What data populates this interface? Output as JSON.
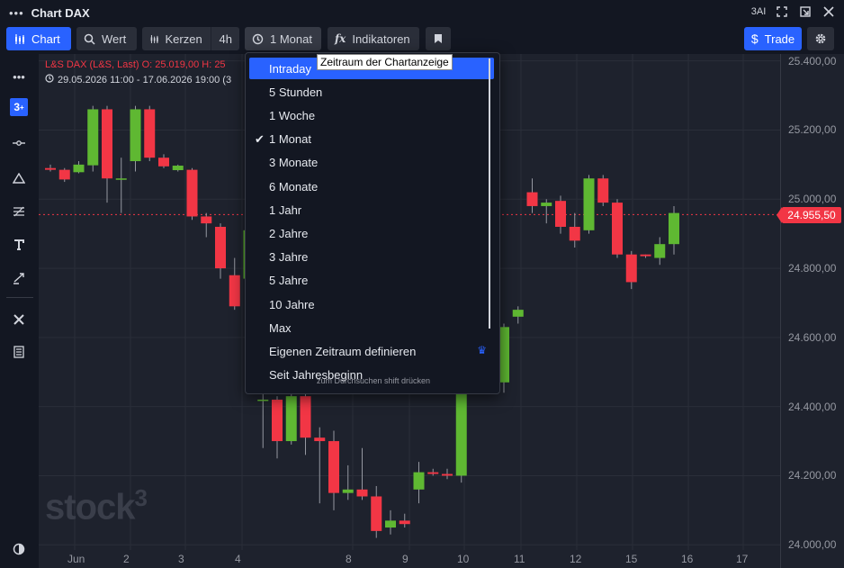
{
  "window": {
    "title": "Chart DAX",
    "brand_label": "3AI"
  },
  "toolbar": {
    "chart_label": "Chart",
    "search_label": "Wert",
    "candles_label": "Kerzen",
    "interval_label": "4h",
    "range_label": "1 Monat",
    "indicators_label": "Indikatoren",
    "trade_label": "Trade"
  },
  "legend": {
    "line1": "L&S DAX (L&S, Last)  O: 25.019,00  H: 25",
    "line2": "29.05.2026 11:00 - 17.06.2026 19:00  (3"
  },
  "price_tag": "24.955,50",
  "watermark": {
    "text": "stock",
    "sup": "3"
  },
  "dropdown": {
    "items": [
      {
        "label": "Intraday",
        "state": "highlighted"
      },
      {
        "label": "5 Stunden"
      },
      {
        "label": "1 Woche"
      },
      {
        "label": "1 Monat",
        "checked": true
      },
      {
        "label": "3 Monate"
      },
      {
        "label": "6 Monate"
      },
      {
        "label": "1 Jahr"
      },
      {
        "label": "2 Jahre"
      },
      {
        "label": "3 Jahre"
      },
      {
        "label": "5 Jahre"
      },
      {
        "label": "10 Jahre"
      },
      {
        "label": "Max"
      },
      {
        "label": "Eigenen Zeitraum definieren",
        "premium": true
      },
      {
        "label": "Seit Jahresbeginn"
      }
    ],
    "hint": "zum Durchsuchen shift drücken"
  },
  "tooltip": "Zeitraum der Chartanzeige",
  "colors": {
    "up": "#5fb832",
    "down": "#f23645",
    "accent": "#2962ff",
    "background": "#1e222d"
  },
  "chart_data": {
    "type": "candlestick",
    "x_tick_labels": [
      "Jun",
      "2",
      "3",
      "4",
      "8",
      "9",
      "10",
      "11",
      "12",
      "15",
      "16",
      "17"
    ],
    "y_tick_labels": [
      "25.400,00",
      "25.200,00",
      "25.000,00",
      "24.800,00",
      "24.600,00",
      "24.400,00",
      "24.200,00",
      "24.000,00"
    ],
    "ylim": [
      23985,
      25420
    ],
    "last_price": 24955.5,
    "candles": [
      {
        "o": 25090,
        "h": 25100,
        "l": 25080,
        "c": 25085
      },
      {
        "o": 25085,
        "h": 25090,
        "l": 25050,
        "c": 25057
      },
      {
        "o": 25078,
        "h": 25110,
        "l": 25075,
        "c": 25100
      },
      {
        "o": 25098,
        "h": 25270,
        "l": 25080,
        "c": 25260
      },
      {
        "o": 25260,
        "h": 25270,
        "l": 24990,
        "c": 25060
      },
      {
        "o": 25060,
        "h": 25120,
        "l": 24960,
        "c": 25060
      },
      {
        "o": 25110,
        "h": 25270,
        "l": 25080,
        "c": 25260
      },
      {
        "o": 25260,
        "h": 25270,
        "l": 25110,
        "c": 25120
      },
      {
        "o": 25120,
        "h": 25130,
        "l": 25090,
        "c": 25095
      },
      {
        "o": 25084,
        "h": 25100,
        "l": 25080,
        "c": 25097
      },
      {
        "o": 25085,
        "h": 25090,
        "l": 24940,
        "c": 24950
      },
      {
        "o": 24950,
        "h": 24960,
        "l": 24890,
        "c": 24930
      },
      {
        "o": 24920,
        "h": 24930,
        "l": 24770,
        "c": 24800
      },
      {
        "o": 24780,
        "h": 24830,
        "l": 24680,
        "c": 24690
      },
      {
        "o": 24770,
        "h": 24920,
        "l": 24700,
        "c": 24910
      },
      {
        "o": 24420,
        "h": 24450,
        "l": 24280,
        "c": 24420
      },
      {
        "o": 24420,
        "h": 24430,
        "l": 24250,
        "c": 24300
      },
      {
        "o": 24300,
        "h": 24450,
        "l": 24290,
        "c": 24430
      },
      {
        "o": 24430,
        "h": 24440,
        "l": 24260,
        "c": 24310
      },
      {
        "o": 24310,
        "h": 24340,
        "l": 24120,
        "c": 24300
      },
      {
        "o": 24300,
        "h": 24330,
        "l": 24100,
        "c": 24150
      },
      {
        "o": 24150,
        "h": 24230,
        "l": 24130,
        "c": 24160
      },
      {
        "o": 24160,
        "h": 24280,
        "l": 24130,
        "c": 24140
      },
      {
        "o": 24140,
        "h": 24170,
        "l": 24020,
        "c": 24040
      },
      {
        "o": 24050,
        "h": 24100,
        "l": 24030,
        "c": 24070
      },
      {
        "o": 24070,
        "h": 24090,
        "l": 24050,
        "c": 24060
      },
      {
        "o": 24160,
        "h": 24240,
        "l": 24120,
        "c": 24210
      },
      {
        "o": 24210,
        "h": 24220,
        "l": 24200,
        "c": 24205
      },
      {
        "o": 24205,
        "h": 24220,
        "l": 24190,
        "c": 24200
      },
      {
        "o": 24200,
        "h": 24620,
        "l": 24180,
        "c": 24610
      },
      {
        "o": 24600,
        "h": 24650,
        "l": 24570,
        "c": 24620
      },
      {
        "o": 24620,
        "h": 24680,
        "l": 24460,
        "c": 24470
      },
      {
        "o": 24470,
        "h": 24640,
        "l": 24440,
        "c": 24630
      },
      {
        "o": 24660,
        "h": 24690,
        "l": 24640,
        "c": 24680
      },
      {
        "o": 25020,
        "h": 25060,
        "l": 24960,
        "c": 24980
      },
      {
        "o": 24980,
        "h": 25000,
        "l": 24930,
        "c": 24990
      },
      {
        "o": 24995,
        "h": 25010,
        "l": 24900,
        "c": 24920
      },
      {
        "o": 24920,
        "h": 24960,
        "l": 24860,
        "c": 24880
      },
      {
        "o": 24910,
        "h": 25070,
        "l": 24900,
        "c": 25060
      },
      {
        "o": 25060,
        "h": 25070,
        "l": 24980,
        "c": 24990
      },
      {
        "o": 24990,
        "h": 25000,
        "l": 24830,
        "c": 24840
      },
      {
        "o": 24840,
        "h": 24850,
        "l": 24740,
        "c": 24760
      },
      {
        "o": 24840,
        "h": 24840,
        "l": 24830,
        "c": 24835
      },
      {
        "o": 24830,
        "h": 24890,
        "l": 24810,
        "c": 24870
      },
      {
        "o": 24870,
        "h": 24980,
        "l": 24840,
        "c": 24960
      }
    ]
  }
}
